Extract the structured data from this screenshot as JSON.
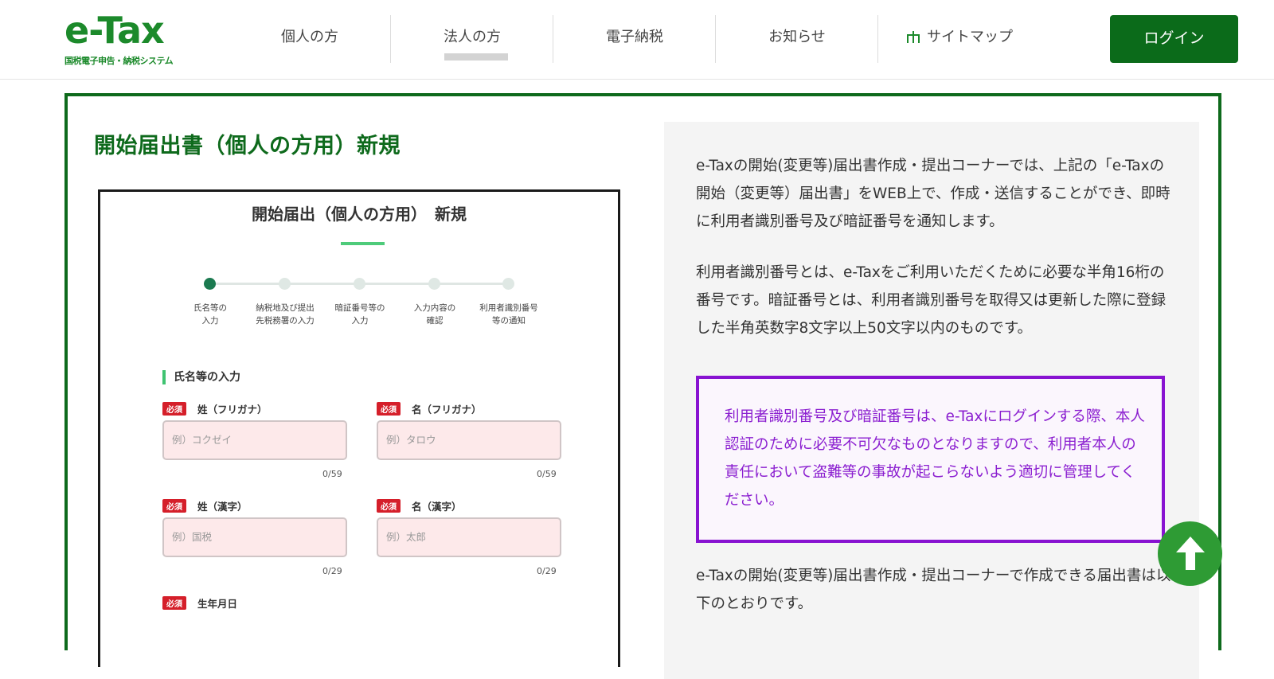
{
  "header": {
    "logo_text": "e-Tax",
    "logo_sub": "国税電子申告・納税システム",
    "nav": [
      {
        "label": "個人の方"
      },
      {
        "label": "法人の方"
      },
      {
        "label": "電子納税"
      },
      {
        "label": "お知らせ"
      },
      {
        "label": "サイトマップ"
      }
    ],
    "login_label": "ログイン"
  },
  "page": {
    "title": "開始届出書（個人の方用）新規"
  },
  "form_image": {
    "title": "開始届出（個人の方用）　新規",
    "steps": [
      {
        "label": "氏名等の\n入力"
      },
      {
        "label": "納税地及び提出\n先税務署の入力"
      },
      {
        "label": "暗証番号等の\n入力"
      },
      {
        "label": "入力内容の\n確認"
      },
      {
        "label": "利用者識別番号\n等の通知"
      }
    ],
    "active_step": 1,
    "section": "氏名等の入力",
    "required_badge": "必須",
    "fields": [
      {
        "label": "姓（フリガナ）",
        "placeholder": "例）コクゼイ",
        "count": "0/59"
      },
      {
        "label": "名（フリガナ）",
        "placeholder": "例）タロウ",
        "count": "0/59"
      },
      {
        "label": "姓（漢字）",
        "placeholder": "例）国税",
        "count": "0/29"
      },
      {
        "label": "名（漢字）",
        "placeholder": "例）太郎",
        "count": "0/29"
      },
      {
        "label": "生年月日"
      }
    ]
  },
  "info": {
    "para1": "e-Taxの開始(変更等)届出書作成・提出コーナーでは、上記の「e-Taxの開始（変更等）届出書」をWEB上で、作成・送信することができ、即時に利用者識別番号及び暗証番号を通知します。",
    "para2": "利用者識別番号とは、e-Taxをご利用いただくために必要な半角16桁の番号です。暗証番号とは、利用者識別番号を取得又は更新した際に登録した半角英数字8文字以上50文字以内のものです。",
    "notice": "利用者識別番号及び暗証番号は、e-Taxにログインする際、本人認証のために必要不可欠なものとなりますので、利用者本人の責任において盗難等の事故が起こらないよう適切に管理してください。",
    "para3": "e-Taxの開始(変更等)届出書作成・提出コーナーで作成できる届出書は以下のとおりです。"
  },
  "colors": {
    "brand_green": "#0b6b1a",
    "notice_purple": "#8813d1",
    "required_red": "#d51f2a"
  },
  "icons": {
    "sitemap": "sitemap-icon",
    "scroll_top": "arrow-up-icon"
  }
}
